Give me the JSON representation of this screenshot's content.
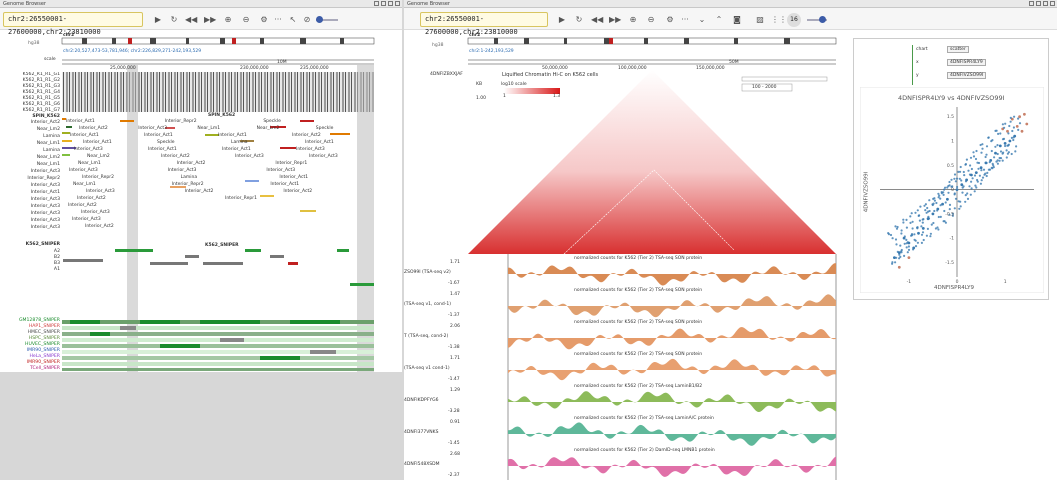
{
  "left": {
    "title": "Genome Browser",
    "locus": "chr2:26550001-27600000,chr2:23810000",
    "genome": "hg38",
    "chrom": "chr2",
    "coords": "chr2:20,527,473-53,781,946; chr2:226,829,271-242,193,529",
    "ticks": [
      "25,000,000",
      "230,000,000",
      "235,000,000"
    ],
    "scale_bar": "10M",
    "scale_label": "scale",
    "tracks": [
      "K562_R1_R1_G1",
      "K562_R1_R1_G2",
      "K562_R1_R1_G3",
      "K562_R1_R1_G4",
      "K562_R1_R1_G5",
      "K562_R1_R1_G6",
      "K562_R1_R1_G7",
      "SPIN_K562",
      "Interior_Act2",
      "Near_Lm2",
      "Lamina",
      "Near_Lm1",
      "Lamina",
      "Near_Lm2",
      "Near_Lm1",
      "Interior_Act3",
      "Interior_Repr2",
      "Interior_Act3",
      "Interior_Act1",
      "Interior_Act3",
      "Interior_Act3",
      "Interior_Act3",
      "Interior_Act3",
      "Interior_Act3"
    ],
    "spin_header": "SPIN_K562",
    "spin_header2": "SPIN_K562",
    "spin_rows": [
      [
        "Interior_Act1",
        "Interior_Repr2",
        "Speckle"
      ],
      [
        "Interior_Act2",
        "Interior_Act3",
        "Near_Lm1",
        "Near_Lm2",
        "Speckle"
      ],
      [
        "Interior_Act1",
        "Interior_Act1",
        "Interior_Act1",
        "Interior_Act2"
      ],
      [
        "Interior_Act1",
        "Speckle",
        "Lamina",
        "Interior_Act1"
      ],
      [
        "Interior_Act3",
        "Interior_Act1",
        "Interior_Act1",
        "Interior_Act3"
      ],
      [
        "Near_Lm2",
        "Interior_Act2",
        "Interior_Act3",
        "Interior_Act3"
      ],
      [
        "Near_Lm1",
        "Interior_Act2",
        "Interior_Repr1"
      ],
      [
        "Interior_Act3",
        "Interior_Act3",
        "Interior_Act3"
      ],
      [
        "Interior_Repr2",
        "Lamina",
        "Interior_Act1"
      ],
      [
        "Near_Lm1",
        "Interior_Repr2",
        "Interior_Act1"
      ],
      [
        "Interior_Act3",
        "Interior_Act2",
        "Interior_Act2"
      ],
      [
        "Interior_Act2",
        "Interior_Repr1"
      ],
      [
        "Interior_Act2"
      ],
      [
        "Interior_Act3"
      ],
      [
        "Interior_Act3"
      ],
      [
        "Interior_Act2"
      ]
    ],
    "sniper_header": "K562_SNIPER",
    "sniper_header2": "K562_SNIPER",
    "sniper_tracks": [
      "A2",
      "B2",
      "B3",
      "A1"
    ],
    "cell_tracks": [
      "GM12878_SNIPER",
      "HAP1_SNIPER",
      "HMEC_SNIPER",
      "HSPC_SNIPER",
      "HUVEC_SNIPER",
      "IMR90_SNIPER",
      "HeLa_SNIPER",
      "IMR90_SNIPER",
      "TCell_SNIPER"
    ],
    "cell_colors": [
      "#1a8c2c",
      "#d03a3a",
      "#4a4a4a",
      "#5a8a3a",
      "#1a8c2c",
      "#2a5ab0",
      "#8a3ad0",
      "#c02020",
      "#b0207a"
    ]
  },
  "right": {
    "title": "Genome Browser",
    "locus": "chr2:26550001-27600000,chr2:23810000",
    "zoom_badge": "16",
    "genome": "hg38",
    "chrom": "chr2",
    "coords": "chr2:1-242,193,529",
    "ticks": [
      "50,000,000",
      "100,000,000",
      "150,000,000"
    ],
    "scale_bar": "50M",
    "hic_track_label": "4DNFIZBXXJAF",
    "hic_title": "Liquified Chromatin Hi-C on K562 cells",
    "kb_label": "KB",
    "hic_legend_title": "log10 scale",
    "hic_legend_min": "1.00",
    "hic_legend_min2": "1",
    "hic_legend_max": "1.3",
    "range_input": "100 - 2000",
    "bigwig": [
      {
        "title": "normalized counts for K562 (Tier 2) TSA-seq SON protein",
        "label": "ZSO99I (TSA-seq v2)",
        "top": "1.71",
        "bottom": "-1.67",
        "color": "#d98b55"
      },
      {
        "title": "normalized counts for K562 (Tier 2) TSA-seq SON protein",
        "label": "(TSA-seq v1, cond-1)",
        "top": "1.47",
        "bottom": "-1.37",
        "color": "#e0a070"
      },
      {
        "title": "normalized counts for K562 (Tier 2) TSA-seq SON protein",
        "label": "T (TSA-seq, cond-2)",
        "top": "2.06",
        "bottom": "-1.38",
        "color": "#e59b6a"
      },
      {
        "title": "normalized counts for K562 (Tier 2) TSA-seq SON protein",
        "label": "(TSA-seq v1 cond-1)",
        "top": "1.71",
        "bottom": "-1.47",
        "color": "#e8a070"
      },
      {
        "title": "normalized counts for K562 (Tier 2) TSA-seq LaminB1/B2",
        "label": "4DNFIKDPFYG6",
        "top": "1.29",
        "bottom": "-3.28",
        "color": "#8dbb5a"
      },
      {
        "title": "normalized counts for K562 (Tier 2) TSA-seq LaminA/C protein",
        "label": "4DNFI377VNKS",
        "top": "0.91",
        "bottom": "-1.45",
        "color": "#5fb89a"
      },
      {
        "title": "normalized counts for K562 (Tier 2) DamID-seq LMNB1 protein",
        "label": "4DNFI548XSDM",
        "top": "2.68",
        "bottom": "-2.37",
        "color": "#e070a8"
      }
    ]
  },
  "scatter_panel": {
    "controls": [
      {
        "label": "chart",
        "value": "scatter"
      },
      {
        "label": "x",
        "value": "4DNFISPR4LY9"
      },
      {
        "label": "y",
        "value": "4DNFIVZSO99I"
      }
    ],
    "title": "4DNFISPR4LY9 vs 4DNFIVZSO99I",
    "xlabel": "4DNFISPR4LY9",
    "ylabel": "4DNFIVZSO99I"
  },
  "chart_data": {
    "type": "scatter",
    "title": "4DNFISPR4LY9 vs 4DNFIVZSO99I",
    "xlabel": "4DNFISPR4LY9",
    "ylabel": "4DNFIVZSO99I",
    "xlim": [
      -1.6,
      1.6
    ],
    "ylim": [
      -1.8,
      1.7
    ],
    "x_ticks": [
      "-1",
      "0",
      "1"
    ],
    "y_ticks": [
      "1.5",
      "1",
      "0.5",
      "0",
      "-0.5",
      "-1",
      "-1.5"
    ],
    "grid": false,
    "series": [
      {
        "color": "#3a7ab0",
        "points": [
          [
            -1.2,
            -1.3
          ],
          [
            -1.0,
            -1.1
          ],
          [
            -0.8,
            -0.9
          ],
          [
            -0.6,
            -0.6
          ],
          [
            -0.4,
            -0.4
          ],
          [
            -0.2,
            -0.2
          ],
          [
            0.0,
            0.0
          ],
          [
            0.2,
            0.2
          ],
          [
            0.4,
            0.35
          ],
          [
            0.6,
            0.55
          ],
          [
            0.8,
            0.75
          ],
          [
            1.0,
            0.95
          ],
          [
            1.2,
            1.1
          ],
          [
            -1.1,
            -1.0
          ],
          [
            -0.9,
            -1.2
          ],
          [
            -0.7,
            -0.8
          ],
          [
            -0.5,
            -0.5
          ],
          [
            -0.3,
            -0.3
          ],
          [
            0.1,
            0.1
          ],
          [
            0.3,
            0.3
          ],
          [
            0.5,
            0.45
          ],
          [
            0.7,
            0.6
          ],
          [
            0.9,
            0.9
          ],
          [
            -1.3,
            -1.4
          ],
          [
            1.1,
            1.0
          ]
        ]
      },
      {
        "color": "#c9826b",
        "points": [
          [
            1.15,
            1.45
          ],
          [
            1.3,
            1.5
          ],
          [
            1.4,
            1.55
          ],
          [
            1.25,
            1.3
          ],
          [
            1.45,
            1.35
          ],
          [
            1.35,
            1.2
          ],
          [
            0.95,
            1.25
          ],
          [
            1.05,
            1.2
          ],
          [
            -1.2,
            -1.6
          ],
          [
            -1.0,
            -1.4
          ]
        ]
      }
    ]
  }
}
